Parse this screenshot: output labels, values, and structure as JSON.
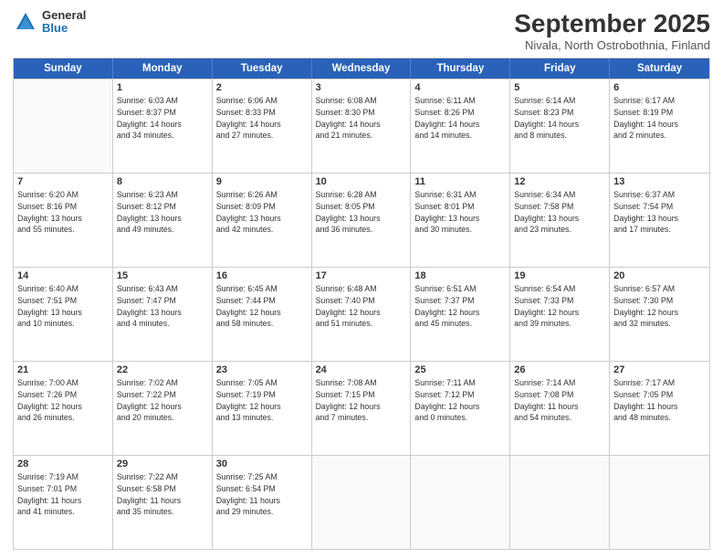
{
  "header": {
    "logo_general": "General",
    "logo_blue": "Blue",
    "month_title": "September 2025",
    "subtitle": "Nivala, North Ostrobothnia, Finland"
  },
  "weekdays": [
    "Sunday",
    "Monday",
    "Tuesday",
    "Wednesday",
    "Thursday",
    "Friday",
    "Saturday"
  ],
  "rows": [
    [
      {
        "day": "",
        "info": ""
      },
      {
        "day": "1",
        "info": "Sunrise: 6:03 AM\nSunset: 8:37 PM\nDaylight: 14 hours\nand 34 minutes."
      },
      {
        "day": "2",
        "info": "Sunrise: 6:06 AM\nSunset: 8:33 PM\nDaylight: 14 hours\nand 27 minutes."
      },
      {
        "day": "3",
        "info": "Sunrise: 6:08 AM\nSunset: 8:30 PM\nDaylight: 14 hours\nand 21 minutes."
      },
      {
        "day": "4",
        "info": "Sunrise: 6:11 AM\nSunset: 8:26 PM\nDaylight: 14 hours\nand 14 minutes."
      },
      {
        "day": "5",
        "info": "Sunrise: 6:14 AM\nSunset: 8:23 PM\nDaylight: 14 hours\nand 8 minutes."
      },
      {
        "day": "6",
        "info": "Sunrise: 6:17 AM\nSunset: 8:19 PM\nDaylight: 14 hours\nand 2 minutes."
      }
    ],
    [
      {
        "day": "7",
        "info": "Sunrise: 6:20 AM\nSunset: 8:16 PM\nDaylight: 13 hours\nand 55 minutes."
      },
      {
        "day": "8",
        "info": "Sunrise: 6:23 AM\nSunset: 8:12 PM\nDaylight: 13 hours\nand 49 minutes."
      },
      {
        "day": "9",
        "info": "Sunrise: 6:26 AM\nSunset: 8:09 PM\nDaylight: 13 hours\nand 42 minutes."
      },
      {
        "day": "10",
        "info": "Sunrise: 6:28 AM\nSunset: 8:05 PM\nDaylight: 13 hours\nand 36 minutes."
      },
      {
        "day": "11",
        "info": "Sunrise: 6:31 AM\nSunset: 8:01 PM\nDaylight: 13 hours\nand 30 minutes."
      },
      {
        "day": "12",
        "info": "Sunrise: 6:34 AM\nSunset: 7:58 PM\nDaylight: 13 hours\nand 23 minutes."
      },
      {
        "day": "13",
        "info": "Sunrise: 6:37 AM\nSunset: 7:54 PM\nDaylight: 13 hours\nand 17 minutes."
      }
    ],
    [
      {
        "day": "14",
        "info": "Sunrise: 6:40 AM\nSunset: 7:51 PM\nDaylight: 13 hours\nand 10 minutes."
      },
      {
        "day": "15",
        "info": "Sunrise: 6:43 AM\nSunset: 7:47 PM\nDaylight: 13 hours\nand 4 minutes."
      },
      {
        "day": "16",
        "info": "Sunrise: 6:45 AM\nSunset: 7:44 PM\nDaylight: 12 hours\nand 58 minutes."
      },
      {
        "day": "17",
        "info": "Sunrise: 6:48 AM\nSunset: 7:40 PM\nDaylight: 12 hours\nand 51 minutes."
      },
      {
        "day": "18",
        "info": "Sunrise: 6:51 AM\nSunset: 7:37 PM\nDaylight: 12 hours\nand 45 minutes."
      },
      {
        "day": "19",
        "info": "Sunrise: 6:54 AM\nSunset: 7:33 PM\nDaylight: 12 hours\nand 39 minutes."
      },
      {
        "day": "20",
        "info": "Sunrise: 6:57 AM\nSunset: 7:30 PM\nDaylight: 12 hours\nand 32 minutes."
      }
    ],
    [
      {
        "day": "21",
        "info": "Sunrise: 7:00 AM\nSunset: 7:26 PM\nDaylight: 12 hours\nand 26 minutes."
      },
      {
        "day": "22",
        "info": "Sunrise: 7:02 AM\nSunset: 7:22 PM\nDaylight: 12 hours\nand 20 minutes."
      },
      {
        "day": "23",
        "info": "Sunrise: 7:05 AM\nSunset: 7:19 PM\nDaylight: 12 hours\nand 13 minutes."
      },
      {
        "day": "24",
        "info": "Sunrise: 7:08 AM\nSunset: 7:15 PM\nDaylight: 12 hours\nand 7 minutes."
      },
      {
        "day": "25",
        "info": "Sunrise: 7:11 AM\nSunset: 7:12 PM\nDaylight: 12 hours\nand 0 minutes."
      },
      {
        "day": "26",
        "info": "Sunrise: 7:14 AM\nSunset: 7:08 PM\nDaylight: 11 hours\nand 54 minutes."
      },
      {
        "day": "27",
        "info": "Sunrise: 7:17 AM\nSunset: 7:05 PM\nDaylight: 11 hours\nand 48 minutes."
      }
    ],
    [
      {
        "day": "28",
        "info": "Sunrise: 7:19 AM\nSunset: 7:01 PM\nDaylight: 11 hours\nand 41 minutes."
      },
      {
        "day": "29",
        "info": "Sunrise: 7:22 AM\nSunset: 6:58 PM\nDaylight: 11 hours\nand 35 minutes."
      },
      {
        "day": "30",
        "info": "Sunrise: 7:25 AM\nSunset: 6:54 PM\nDaylight: 11 hours\nand 29 minutes."
      },
      {
        "day": "",
        "info": ""
      },
      {
        "day": "",
        "info": ""
      },
      {
        "day": "",
        "info": ""
      },
      {
        "day": "",
        "info": ""
      }
    ]
  ]
}
